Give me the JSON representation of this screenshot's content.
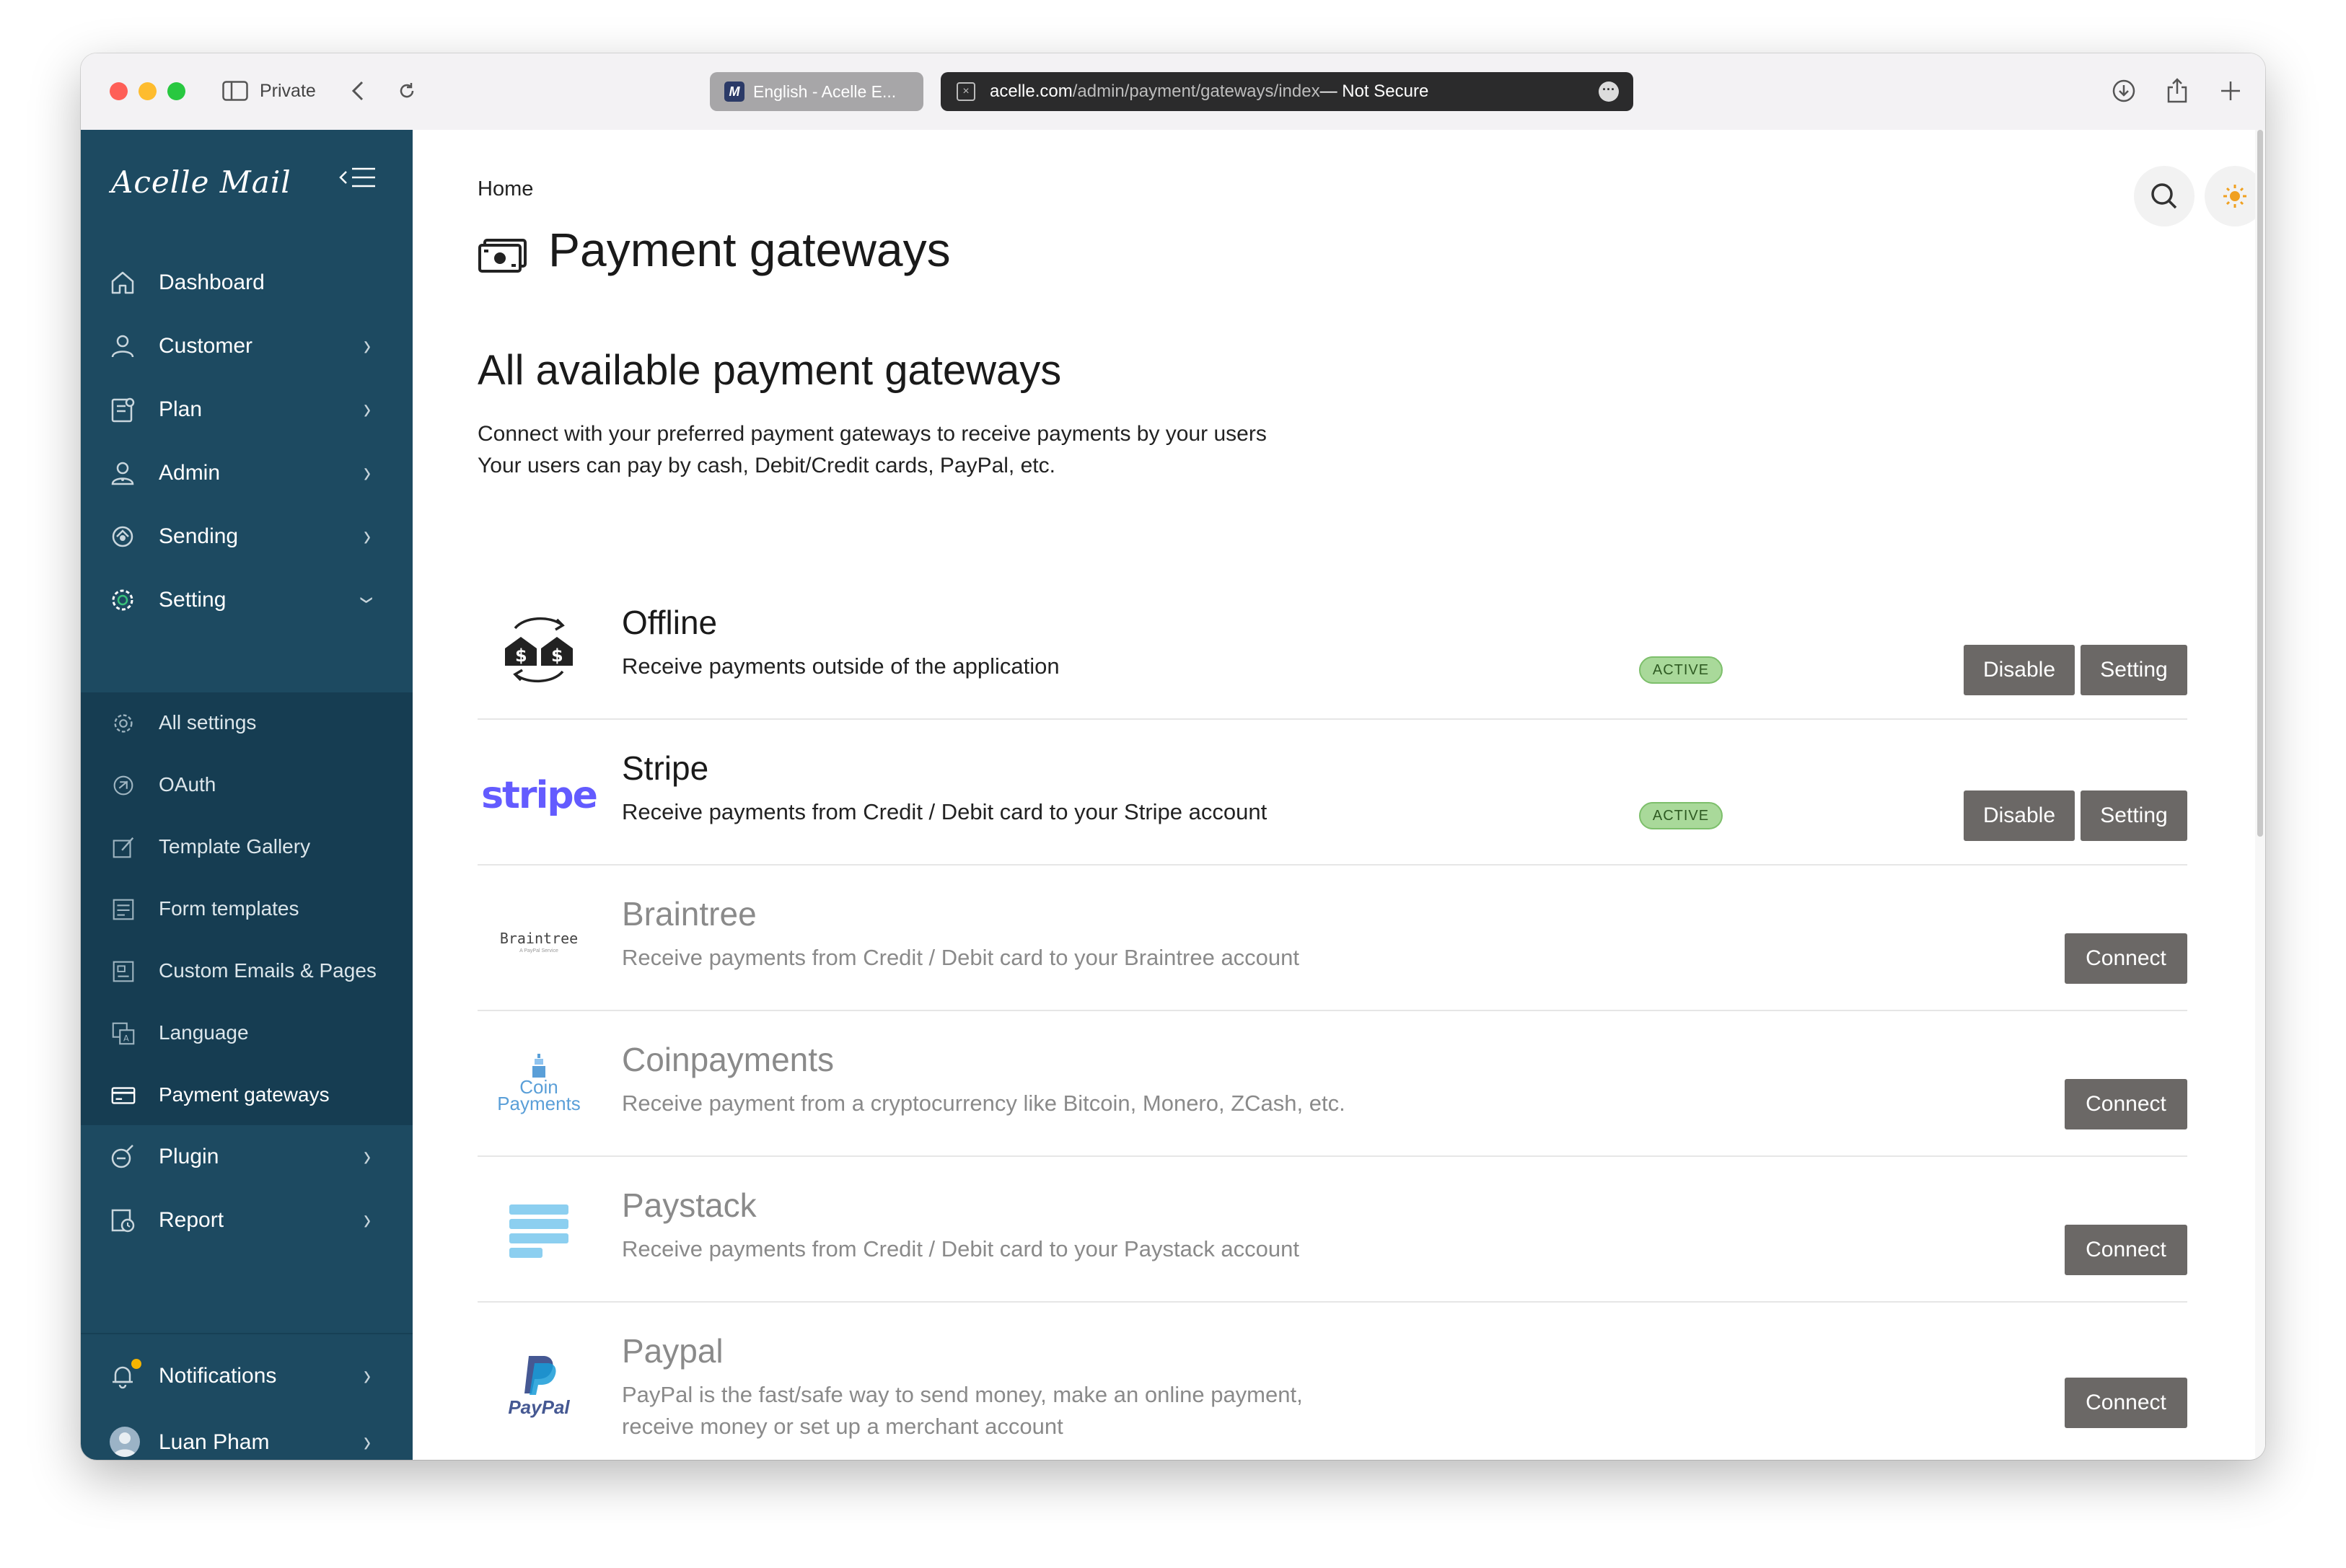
{
  "browser": {
    "private_label": "Private",
    "tab_inactive": "English - Acelle E...",
    "tab_inactive_favicon": "M",
    "url_host": "acelle.com",
    "url_path": "/admin/payment/gateways/index",
    "url_suffix": " — Not Secure"
  },
  "sidebar": {
    "logo": "Acelle Mail",
    "items": [
      {
        "label": "Dashboard",
        "icon": "home-icon"
      },
      {
        "label": "Customer",
        "icon": "user-icon"
      },
      {
        "label": "Plan",
        "icon": "plan-icon"
      },
      {
        "label": "Admin",
        "icon": "admin-icon"
      },
      {
        "label": "Sending",
        "icon": "sending-icon"
      },
      {
        "label": "Setting",
        "icon": "gear-icon"
      }
    ],
    "settings_sub": [
      {
        "label": "All settings",
        "icon": "gear-icon"
      },
      {
        "label": "OAuth",
        "icon": "oauth-icon"
      },
      {
        "label": "Template Gallery",
        "icon": "template-icon"
      },
      {
        "label": "Form templates",
        "icon": "form-icon"
      },
      {
        "label": "Custom Emails & Pages",
        "icon": "custom-pages-icon"
      },
      {
        "label": "Language",
        "icon": "language-icon"
      },
      {
        "label": "Payment gateways",
        "icon": "card-icon"
      }
    ],
    "items2": [
      {
        "label": "Plugin",
        "icon": "plugin-icon"
      },
      {
        "label": "Report",
        "icon": "report-icon"
      }
    ],
    "notifications": "Notifications",
    "user": "Luan Pham"
  },
  "main": {
    "breadcrumb": "Home",
    "title": "Payment gateways",
    "section_title": "All available payment gateways",
    "desc_line1": "Connect with your preferred payment gateways to receive payments by your users",
    "desc_line2": "Your users can pay by cash, Debit/Credit cards, PayPal, etc.",
    "gateways": [
      {
        "name": "Offline",
        "desc": "Receive payments outside of the application",
        "status": "ACTIVE",
        "btn1": "Disable",
        "btn2": "Setting"
      },
      {
        "name": "Stripe",
        "desc": "Receive payments from Credit / Debit card to your Stripe account",
        "status": "ACTIVE",
        "btn1": "Disable",
        "btn2": "Setting",
        "logo_text": "stripe"
      },
      {
        "name": "Braintree",
        "desc": "Receive payments from Credit / Debit card to your Braintree account",
        "btn": "Connect",
        "logo_text": "Braintree",
        "logo_sub": "A PayPal Service"
      },
      {
        "name": "Coinpayments",
        "desc": "Receive payment from a cryptocurrency like Bitcoin, Monero, ZCash, etc.",
        "btn": "Connect",
        "logo_text1": "Coin",
        "logo_text2": "Payments"
      },
      {
        "name": "Paystack",
        "desc": "Receive payments from Credit / Debit card to your Paystack account",
        "btn": "Connect"
      },
      {
        "name": "Paypal",
        "desc1": "PayPal is the fast/safe way to send money, make an online payment,",
        "desc2": "receive money or set up a merchant account",
        "btn": "Connect",
        "logo_text": "PayPal"
      }
    ]
  },
  "colors": {
    "sidebar_bg": "#1d4a61",
    "submenu_bg": "#163d52",
    "badge_green": "#a9d99a",
    "button_gray": "#6b6866",
    "stripe_blue": "#635bff",
    "paypal_blue": "#253b80",
    "paystack_blue": "#3bb6e8"
  }
}
